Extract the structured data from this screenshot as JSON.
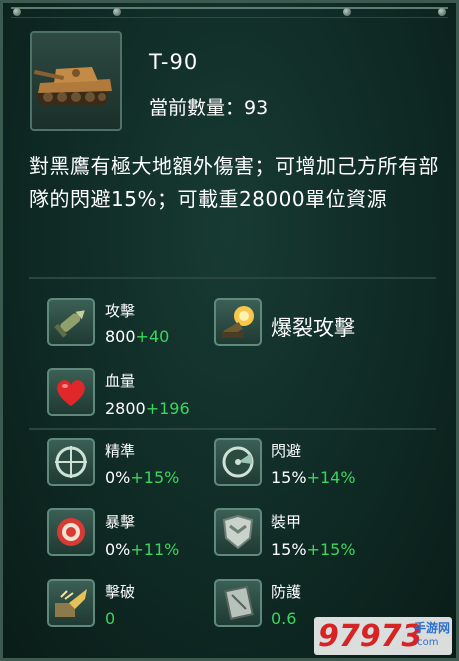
{
  "unit": {
    "name": "T-90",
    "count_label": "當前數量：93"
  },
  "description": "對黑鷹有極大地額外傷害；可增加己方所有部隊的閃避15%；可載重28000單位資源",
  "special": {
    "label": "爆裂攻擊",
    "icon": "explosion-icon"
  },
  "stats": {
    "attack": {
      "label": "攻擊",
      "base": "800",
      "bonus": "+40",
      "icon": "missile-icon"
    },
    "health": {
      "label": "血量",
      "base": "2800",
      "bonus": "+196",
      "icon": "heart-icon"
    },
    "accuracy": {
      "label": "精準",
      "base": "0%",
      "bonus": "+15%",
      "icon": "crosshair-icon"
    },
    "evasion": {
      "label": "閃避",
      "base": "15%",
      "bonus": "+14%",
      "icon": "radar-icon"
    },
    "critical": {
      "label": "暴擊",
      "base": "0%",
      "bonus": "+11%",
      "icon": "target-icon"
    },
    "armor": {
      "label": "裝甲",
      "base": "15%",
      "bonus": "+15%",
      "icon": "shield-emblem-icon"
    },
    "pierce": {
      "label": "擊破",
      "base": "0",
      "bonus": "",
      "icon": "armor-break-icon"
    },
    "defense": {
      "label": "防護",
      "base": "0.6",
      "bonus": "",
      "icon": "defense-plate-icon"
    }
  },
  "watermark": {
    "number": "97973",
    "cn": "手游网",
    "domain": ".com"
  },
  "colors": {
    "bonus": "#3bd65d",
    "panel": "#0f2a24",
    "border": "#4f7267"
  }
}
